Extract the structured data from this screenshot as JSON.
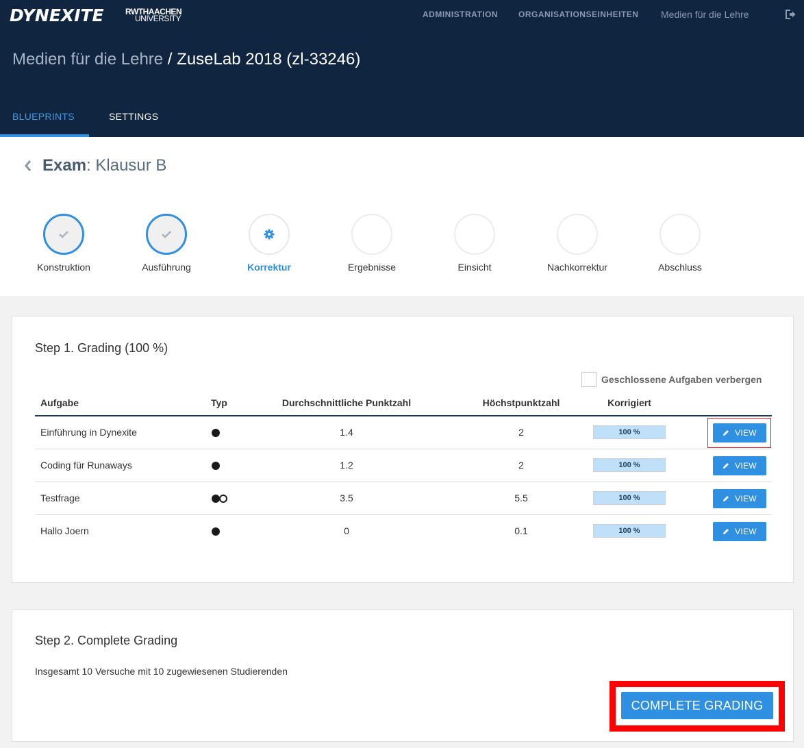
{
  "header": {
    "logo": "DYNEXITE",
    "university_line1": "RWTHAACHEN",
    "university_line2": "UNIVERSITY",
    "nav": {
      "administration": "ADMINISTRATION",
      "organisation": "ORGANISATIONSEINHEITEN",
      "media": "Medien für die Lehre"
    },
    "breadcrumb_parent": "Medien für die Lehre",
    "breadcrumb_separator": " / ",
    "breadcrumb_current": "ZuseLab 2018 (zl-33246)",
    "tabs": {
      "blueprints": "BLUEPRINTS",
      "settings": "SETTINGS"
    }
  },
  "exam": {
    "label": "Exam",
    "name": ": Klausur B"
  },
  "steps": [
    {
      "label": "Konstruktion",
      "state": "done"
    },
    {
      "label": "Ausführung",
      "state": "done"
    },
    {
      "label": "Korrektur",
      "state": "active"
    },
    {
      "label": "Ergebnisse",
      "state": "pending"
    },
    {
      "label": "Einsicht",
      "state": "pending"
    },
    {
      "label": "Nachkorrektur",
      "state": "pending"
    },
    {
      "label": "Abschluss",
      "state": "pending"
    }
  ],
  "grading": {
    "title": "Step 1. Grading (100 %)",
    "hide_closed_label": "Geschlossene Aufgaben verbergen",
    "columns": {
      "task": "Aufgabe",
      "type": "Typ",
      "avg": "Durchschnittliche Punktzahl",
      "max": "Höchstpunktzahl",
      "corrected": "Korrigiert"
    },
    "rows": [
      {
        "task": "Einführung in Dynexite",
        "type": "single",
        "avg": "1.4",
        "max": "2",
        "progress": 1.0,
        "progress_text": "100 %",
        "button": "VIEW"
      },
      {
        "task": "Coding für Runaways",
        "type": "single",
        "avg": "1.2",
        "max": "2",
        "progress": 1.0,
        "progress_text": "100 %",
        "button": "VIEW"
      },
      {
        "task": "Testfrage",
        "type": "multi",
        "avg": "3.5",
        "max": "5.5",
        "progress": 1.0,
        "progress_text": "100 %",
        "button": "VIEW"
      },
      {
        "task": "Hallo Joern",
        "type": "single",
        "avg": "0",
        "max": "0.1",
        "progress": 1.0,
        "progress_text": "100 %",
        "button": "VIEW"
      }
    ]
  },
  "complete": {
    "title": "Step 2. Complete Grading",
    "attempts_text": "Insgesamt 10 Versuche mit 10 zugewiesenen Studierenden",
    "button": "COMPLETE GRADING"
  },
  "colors": {
    "header_bg": "#0f2540",
    "accent": "#2f8fe0",
    "progress_fill": "#bfe0f8",
    "highlight": "#ff0000"
  }
}
